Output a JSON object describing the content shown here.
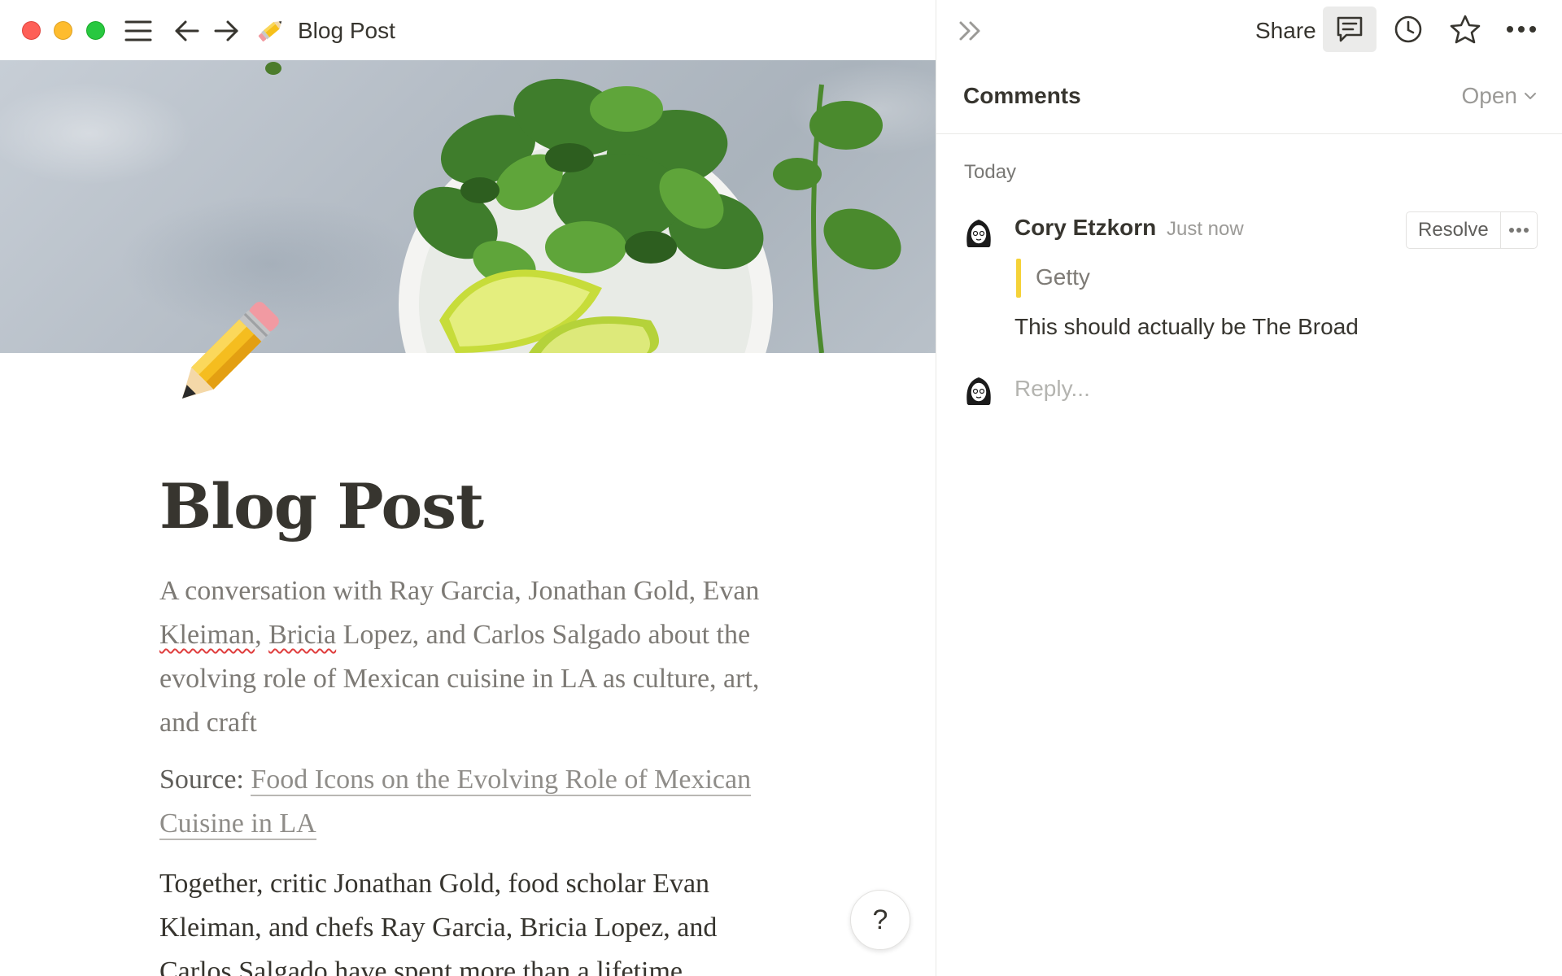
{
  "window": {
    "title": "Blog Post"
  },
  "page": {
    "title": "Blog Post",
    "intro_part1": "A conversation with Ray Garcia, Jonathan Gold, Evan ",
    "intro_name1": "Kleiman",
    "intro_part2": ", ",
    "intro_name2": "Bricia",
    "intro_part3": " Lopez, and Carlos Salgado about the evolving role of Mexican cuisine in LA as culture, art, and craft",
    "source_label": "Source: ",
    "source_link": "Food Icons on the Evolving Role of Mexican Cuisine in LA",
    "body": "Together, critic Jonathan Gold, food scholar Evan Kleiman, and chefs Ray Garcia, Bricia Lopez, and Carlos Salgado have spent more than a lifetime",
    "help_label": "?"
  },
  "panel": {
    "share_label": "Share",
    "header_title": "Comments",
    "filter_label": "Open",
    "date_group": "Today",
    "comment": {
      "author": "Cory Etzkorn",
      "time": "Just now",
      "quote": "Getty",
      "text": "This should actually be The Broad",
      "resolve_label": "Resolve"
    },
    "reply_placeholder": "Reply..."
  },
  "colors": {
    "quote_bar": "#f5d238",
    "close": "#fe5f57",
    "minimize": "#febc2e",
    "zoom": "#28c840"
  },
  "icons": [
    "menu-icon",
    "back-arrow-icon",
    "forward-arrow-icon",
    "pencil-emoji-icon",
    "collapse-panel-icon",
    "comment-icon",
    "history-clock-icon",
    "star-icon",
    "more-dots-icon",
    "chevron-down-icon"
  ]
}
